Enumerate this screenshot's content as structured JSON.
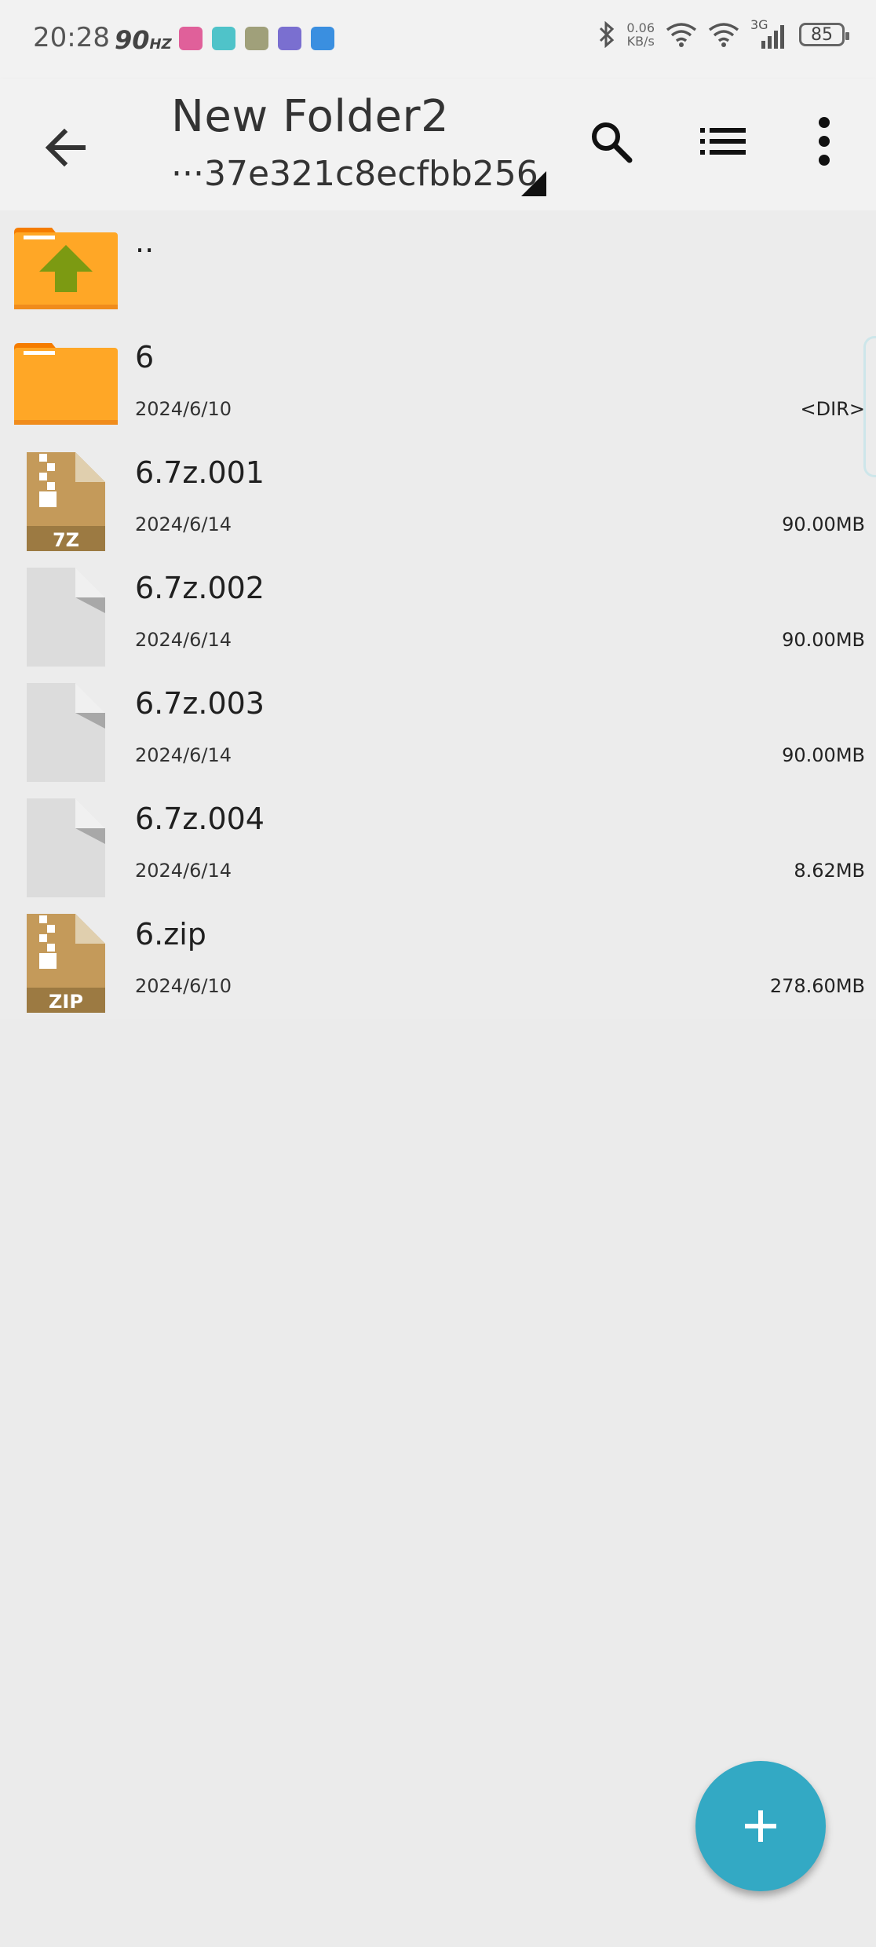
{
  "status_bar": {
    "time": "20:28",
    "refresh_rate": "90",
    "refresh_unit": "HZ",
    "net_speed_value": "0.06",
    "net_speed_unit": "KB/s",
    "network_type": "3G",
    "battery": "85",
    "icons": [
      "app-notification-icon",
      "app-notification-icon",
      "app-notification-icon",
      "app-notification-icon",
      "app-notification-icon",
      "bluetooth-icon",
      "wifi-icon",
      "wifi-icon",
      "signal-icon",
      "battery-icon"
    ]
  },
  "appbar": {
    "title": "New Folder2",
    "subtitle": "···37e321c8ecfbb256",
    "back_icon": "arrow-left-icon",
    "actions": [
      "search-icon",
      "list-view-icon",
      "more-vert-icon"
    ]
  },
  "files": [
    {
      "name": "..",
      "date": "",
      "size": "",
      "icon": "folder-up-icon"
    },
    {
      "name": "6",
      "date": "2024/6/10",
      "size": "<DIR>",
      "icon": "folder-icon"
    },
    {
      "name": "6.7z.001",
      "date": "2024/6/14",
      "size": "90.00MB",
      "icon": "archive-icon",
      "badge": "7Z"
    },
    {
      "name": "6.7z.002",
      "date": "2024/6/14",
      "size": "90.00MB",
      "icon": "file-icon"
    },
    {
      "name": "6.7z.003",
      "date": "2024/6/14",
      "size": "90.00MB",
      "icon": "file-icon"
    },
    {
      "name": "6.7z.004",
      "date": "2024/6/14",
      "size": "8.62MB",
      "icon": "file-icon"
    },
    {
      "name": "6.zip",
      "date": "2024/6/10",
      "size": "278.60MB",
      "icon": "archive-icon",
      "badge": "ZIP"
    }
  ],
  "fab": {
    "icon": "plus-icon"
  },
  "colors": {
    "accent": "#33a9c4",
    "folder": "#ffa726",
    "folder_tab": "#f57c00",
    "archive": "#c49a5a",
    "archive_dark": "#9c7a42",
    "up_arrow": "#7c9a12"
  }
}
